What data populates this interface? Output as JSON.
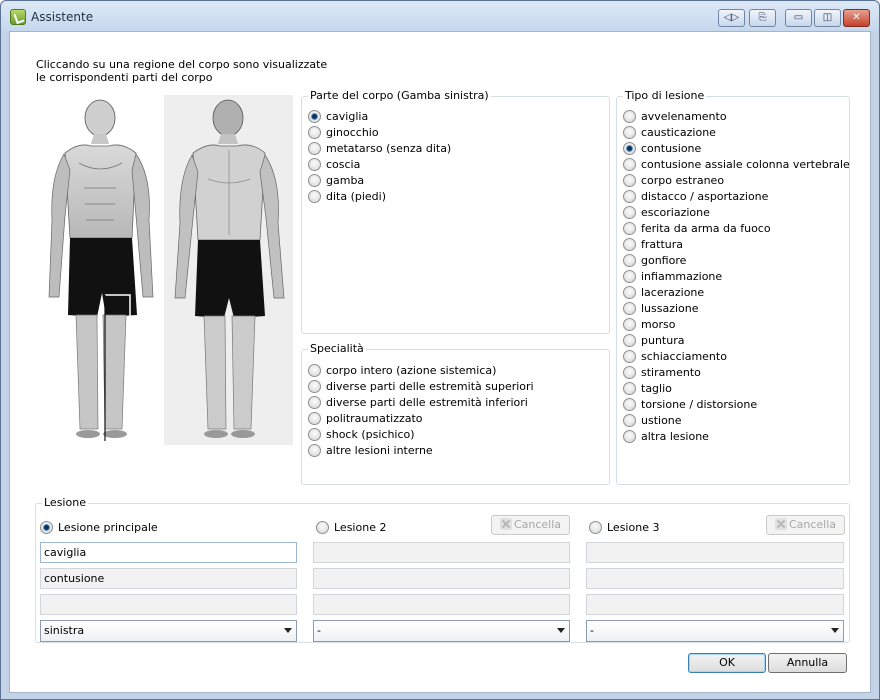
{
  "window": {
    "title": "Assistente",
    "buttons": [
      "◁▷",
      "⎘",
      "▭",
      "◫",
      "✕"
    ]
  },
  "intro": {
    "line1": "Cliccando su una regione del corpo sono visualizzate",
    "line2": "le corrispondenti parti del corpo"
  },
  "body_part": {
    "title": "Parte del corpo (Gamba sinistra)",
    "options": [
      "caviglia",
      "ginocchio",
      "metatarso (senza dita)",
      "coscia",
      "gamba",
      "dita (piedi)"
    ],
    "selected": "caviglia"
  },
  "specialita": {
    "title": "Specialità",
    "options": [
      "corpo intero (azione sistemica)",
      "diverse parti delle estremità superiori",
      "diverse parti delle estremità inferiori",
      "politraumatizzato",
      "shock (psichico)",
      "altre lesioni interne"
    ]
  },
  "lesion_type": {
    "title": "Tipo di lesione",
    "options": [
      "avvelenamento",
      "causticazione",
      "contusione",
      "contusione assiale colonna vertebrale",
      "corpo estraneo",
      "distacco / asportazione",
      "escoriazione",
      "ferita da arma da fuoco",
      "frattura",
      "gonfiore",
      "infiammazione",
      "lacerazione",
      "lussazione",
      "morso",
      "puntura",
      "schiacciamento",
      "stiramento",
      "taglio",
      "torsione / distorsione",
      "ustione",
      "altra lesione"
    ],
    "selected": "contusione"
  },
  "lesione": {
    "title": "Lesione",
    "main_label": "Lesione principale",
    "second_label": "Lesione 2",
    "third_label": "Lesione 3",
    "cancel_label": "Cancella",
    "main_values": [
      "caviglia",
      "contusione",
      ""
    ],
    "main_side": "sinistra",
    "second_side": "-",
    "third_side": "-"
  },
  "footer": {
    "ok": "OK",
    "cancel": "Annulla"
  }
}
